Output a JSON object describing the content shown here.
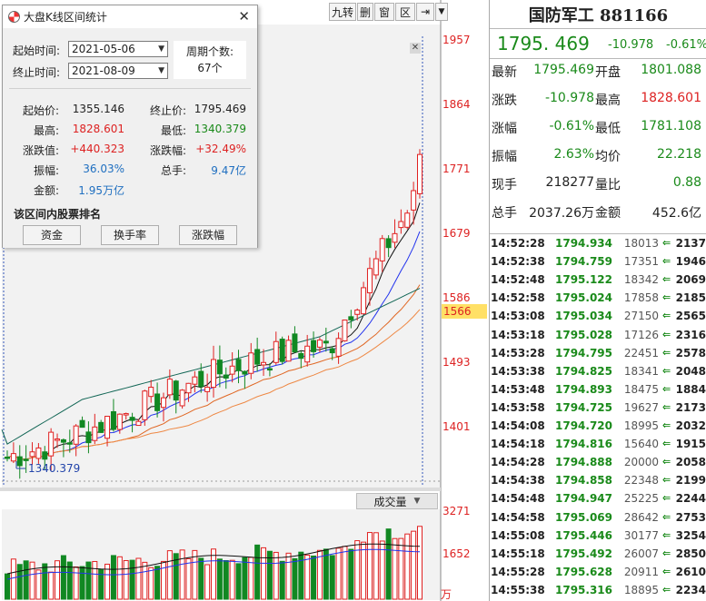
{
  "toolbar": {
    "buttons": [
      "九转",
      "删",
      "窗",
      "区",
      "⇥"
    ]
  },
  "price_axis": {
    "labels": [
      "1957",
      "1864",
      "1771",
      "1679",
      "1586",
      "1493",
      "1401"
    ],
    "current_price_tag": "1566"
  },
  "main_chart": {
    "min_label": "1340.379",
    "y_range": [
      1320,
      1980
    ],
    "ma_colors": [
      "#111111",
      "#2233ee",
      "#e06622",
      "#ee8844",
      "#116655"
    ]
  },
  "volume": {
    "tab_label": "成交量",
    "axis_labels": [
      "3271",
      "1652"
    ],
    "unit_label": "万"
  },
  "dialog": {
    "title": "大盘K线区间统计",
    "start_label": "起始时间:",
    "start_value": "2021-05-06",
    "end_label": "终止时间:",
    "end_value": "2021-08-09",
    "period_label": "周期个数:",
    "period_value": "67个",
    "stats": {
      "start_price_label": "起始价:",
      "start_price": "1355.146",
      "end_price_label": "终止价:",
      "end_price": "1795.469",
      "high_label": "最高:",
      "high": "1828.601",
      "low_label": "最低:",
      "low": "1340.379",
      "change_label": "涨跌值:",
      "change": "+440.323",
      "change_pct_label": "涨跌幅:",
      "change_pct": "+32.49%",
      "amplitude_label": "振幅:",
      "amplitude": "36.03%",
      "turnover_label": "总手:",
      "turnover": "9.47亿",
      "amount_label": "金额:",
      "amount": "1.95万亿"
    },
    "rank_title": "该区间内股票排名",
    "rank_buttons": [
      "资金",
      "换手率",
      "涨跌幅"
    ]
  },
  "quote": {
    "title": "国防军工 881166",
    "price": "1795. 469",
    "change": "-10.978",
    "change_pct": "-0.61%",
    "rows": [
      {
        "k1": "最新",
        "v1": "1795.469",
        "c1": "green",
        "k2": "开盘",
        "v2": "1801.088",
        "c2": "green"
      },
      {
        "k1": "涨跌",
        "v1": "-10.978",
        "c1": "green",
        "k2": "最高",
        "v2": "1828.601",
        "c2": "red"
      },
      {
        "k1": "涨幅",
        "v1": "-0.61%",
        "c1": "green",
        "k2": "最低",
        "v2": "1781.108",
        "c2": "green"
      },
      {
        "k1": "振幅",
        "v1": "2.63%",
        "c1": "green",
        "k2": "均价",
        "v2": "22.218",
        "c2": "green"
      },
      {
        "k1": "现手",
        "v1": "218277",
        "c1": "black",
        "k2": "量比",
        "v2": "0.88",
        "c2": "green"
      },
      {
        "k1": "总手",
        "v1": "2037.26万",
        "c1": "black",
        "k2": "金额",
        "v2": "452.6亿",
        "c2": "black"
      }
    ],
    "ticks": [
      {
        "t": "14:52:28",
        "p": "1794.934",
        "v": "18013",
        "n": "2137"
      },
      {
        "t": "14:52:38",
        "p": "1794.759",
        "v": "17351",
        "n": "1946"
      },
      {
        "t": "14:52:48",
        "p": "1795.122",
        "v": "18342",
        "n": "2069"
      },
      {
        "t": "14:52:58",
        "p": "1795.024",
        "v": "17858",
        "n": "2185"
      },
      {
        "t": "14:53:08",
        "p": "1795.034",
        "v": "27150",
        "n": "2565"
      },
      {
        "t": "14:53:18",
        "p": "1795.028",
        "v": "17126",
        "n": "2316"
      },
      {
        "t": "14:53:28",
        "p": "1794.795",
        "v": "22451",
        "n": "2578"
      },
      {
        "t": "14:53:38",
        "p": "1794.825",
        "v": "18341",
        "n": "2048"
      },
      {
        "t": "14:53:48",
        "p": "1794.893",
        "v": "18475",
        "n": "1884"
      },
      {
        "t": "14:53:58",
        "p": "1794.725",
        "v": "19627",
        "n": "2173"
      },
      {
        "t": "14:54:08",
        "p": "1794.720",
        "v": "18995",
        "n": "2032"
      },
      {
        "t": "14:54:18",
        "p": "1794.816",
        "v": "15640",
        "n": "1915"
      },
      {
        "t": "14:54:28",
        "p": "1794.888",
        "v": "20000",
        "n": "2058"
      },
      {
        "t": "14:54:38",
        "p": "1794.858",
        "v": "22348",
        "n": "2199"
      },
      {
        "t": "14:54:48",
        "p": "1794.947",
        "v": "25225",
        "n": "2244"
      },
      {
        "t": "14:54:58",
        "p": "1795.069",
        "v": "28642",
        "n": "2753"
      },
      {
        "t": "14:55:08",
        "p": "1795.446",
        "v": "30177",
        "n": "3254"
      },
      {
        "t": "14:55:18",
        "p": "1795.492",
        "v": "26007",
        "n": "2850"
      },
      {
        "t": "14:55:28",
        "p": "1795.628",
        "v": "20911",
        "n": "2610"
      },
      {
        "t": "14:55:38",
        "p": "1795.316",
        "v": "18895",
        "n": "2234"
      }
    ]
  }
}
